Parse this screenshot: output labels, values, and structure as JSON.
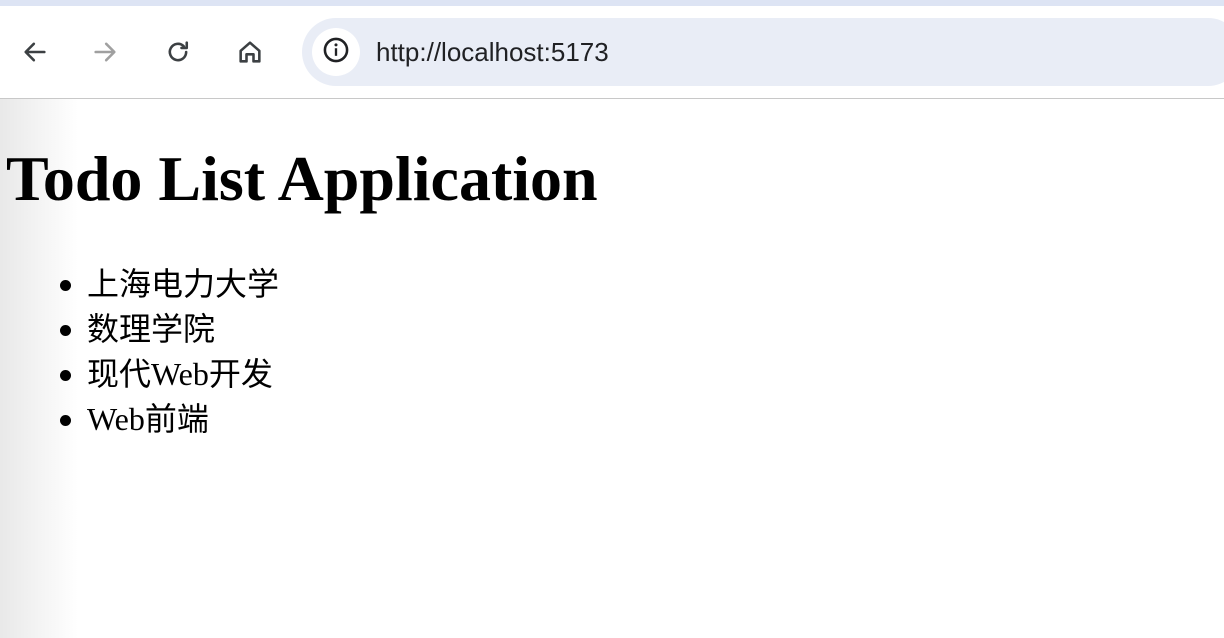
{
  "browser": {
    "url": "http://localhost:5173",
    "icons": {
      "back": "back-arrow-icon",
      "forward": "forward-arrow-icon",
      "reload": "reload-icon",
      "home": "home-icon",
      "site_info": "info-icon"
    },
    "colors": {
      "top_strip": "#dde4f4",
      "omnibox": "#e9edf6",
      "icon_active": "#3c4043",
      "icon_disabled": "#a0a0a0"
    }
  },
  "page": {
    "title": "Todo List Application",
    "todos": [
      "上海电力大学",
      "数理学院",
      "现代Web开发",
      "Web前端"
    ]
  }
}
